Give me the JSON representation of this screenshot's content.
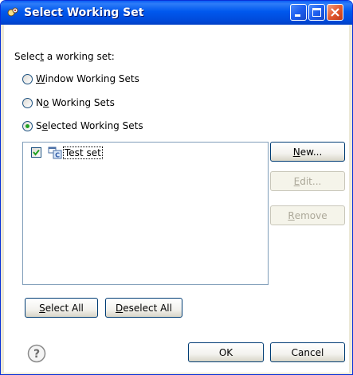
{
  "window": {
    "title": "Select Working Set",
    "icon": "eclipse-working-set-icon"
  },
  "title_buttons": {
    "minimize": "minimize-icon",
    "maximize": "maximize-icon",
    "close": "close-icon"
  },
  "prompt": {
    "before": "Selec",
    "mnemonic": "t",
    "after": " a working set:"
  },
  "options": [
    {
      "before": "",
      "mnemonic": "W",
      "after": "indow Working Sets",
      "selected": false
    },
    {
      "before": "N",
      "mnemonic": "o",
      "after": " Working Sets",
      "selected": false
    },
    {
      "before": "S",
      "mnemonic": "e",
      "after": "lected Working Sets",
      "selected": true
    }
  ],
  "working_sets": [
    {
      "label": "Test set",
      "checked": true,
      "icon": "java-working-set-icon"
    }
  ],
  "side_buttons": {
    "new": {
      "mnemonic": "N",
      "after": "ew...",
      "enabled": true
    },
    "edit": {
      "mnemonic": "E",
      "after": "dit...",
      "enabled": false
    },
    "remove": {
      "mnemonic": "R",
      "after": "emove",
      "enabled": false
    }
  },
  "bottom_buttons": {
    "select_all": {
      "mnemonic": "S",
      "after": "elect All"
    },
    "deselect_all": {
      "mnemonic": "D",
      "after": "eselect All"
    }
  },
  "dialog_buttons": {
    "ok": "OK",
    "cancel": "Cancel"
  },
  "help": {
    "icon": "help-icon"
  },
  "colors": {
    "titlebar": "#0058ee",
    "radio_dot": "#21a121",
    "check": "#21a121",
    "list_border": "#7f9db9"
  }
}
